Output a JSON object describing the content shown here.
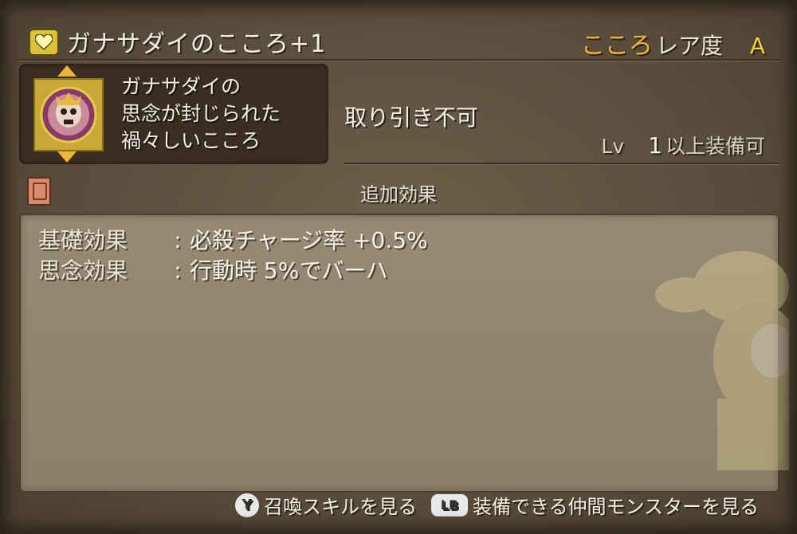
{
  "header": {
    "item_name": "ガナサダイのこころ+1",
    "kokoro_label": "こころ",
    "rarity_label": "レア度",
    "rarity_grade": "A"
  },
  "card": {
    "description_lines": [
      "ガナサダイの",
      "思念が封じられた",
      "禍々しいこころ"
    ]
  },
  "trade_status": "取り引き不可",
  "level": {
    "prefix": "Lv",
    "value": "1",
    "suffix": "以上装備可"
  },
  "section_title": "追加効果",
  "effects": [
    {
      "label": "基礎効果",
      "sep": ":",
      "value": "必殺チャージ率 +0.5%"
    },
    {
      "label": "思念効果",
      "sep": ":",
      "value": "行動時 5%でバーハ"
    }
  ],
  "footer": {
    "y_button": "Y",
    "y_action": "召喚スキルを見る",
    "lb_button": "LB",
    "lb_action": "装備できる仲間モンスターを見る"
  },
  "colors": {
    "kokoro_accent": "#f2b332",
    "rarity_grade": "#f5d33a",
    "arrow": "#f0b43a"
  },
  "icons": [
    "heart-icon",
    "book-icon",
    "y-button-icon",
    "lb-button-icon"
  ]
}
